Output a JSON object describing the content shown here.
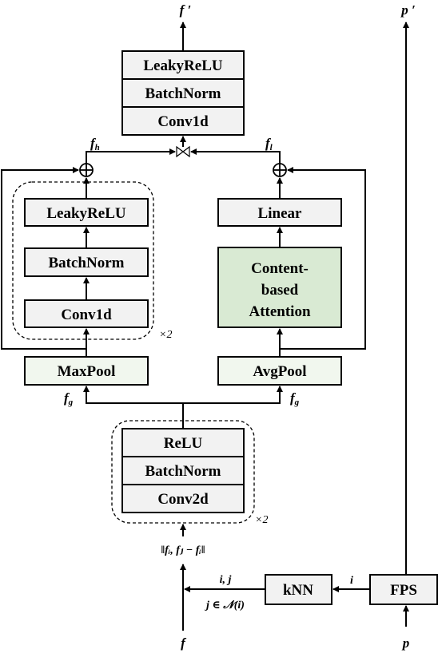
{
  "outputs": {
    "features": "f ′",
    "points": "p ′"
  },
  "top_stack": [
    "LeakyReLU",
    "BatchNorm",
    "Conv1d"
  ],
  "labels": {
    "f_h": "f",
    "f_h_sub": "h",
    "f_l": "f",
    "f_l_sub": "l",
    "f_g": "f",
    "f_g_sub": "g"
  },
  "left_branch": {
    "blocks": [
      "LeakyReLU",
      "BatchNorm",
      "Conv1d"
    ],
    "repeat": "×2",
    "pool": "MaxPool"
  },
  "right_branch": {
    "linear": "Linear",
    "attention": [
      "Content-",
      "based",
      "Attention"
    ],
    "pool": "AvgPool"
  },
  "edge_stack": {
    "blocks": [
      "ReLU",
      "BatchNorm",
      "Conv2d"
    ],
    "repeat": "×2",
    "input_label": "‖fᵢ, fⱼ − fᵢ‖"
  },
  "bottom": {
    "knn": "kNN",
    "fps": "FPS",
    "ij_label": "i, j",
    "neighbor_label": "j ∈ 𝒩(i)",
    "i_label": "i",
    "f_input": "f",
    "p_input": "p"
  },
  "colors": {
    "box": "#f2f2f2",
    "attention": "#d9ead3",
    "pool": "#f1f7ee",
    "line": "#000000"
  }
}
